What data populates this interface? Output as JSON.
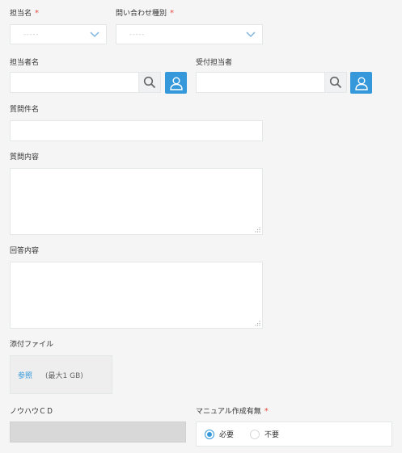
{
  "form": {
    "assignee_select": {
      "label": "担当名",
      "required_mark": "*",
      "placeholder": "-----"
    },
    "inquiry_type_select": {
      "label": "問い合わせ種別",
      "required_mark": "*",
      "placeholder": "-----"
    },
    "assignee_name": {
      "label": "担当者名",
      "value": ""
    },
    "receiver": {
      "label": "受付担当者",
      "value": ""
    },
    "question_title": {
      "label": "質問件名",
      "value": ""
    },
    "question_content": {
      "label": "質問内容",
      "value": ""
    },
    "answer_content": {
      "label": "回答内容",
      "value": ""
    },
    "attachment": {
      "label": "添付ファイル",
      "browse_label": "参照",
      "limit": "(最大1 GB)"
    },
    "knowhow_cd": {
      "label": "ノウハウＣＤ",
      "value": ""
    },
    "manual_creation": {
      "label": "マニュアル作成有無",
      "required_mark": "*",
      "options": [
        {
          "label": "必要",
          "checked": true
        },
        {
          "label": "不要",
          "checked": false
        }
      ]
    }
  },
  "colors": {
    "accent": "#3498db",
    "required": "#e74c3c",
    "background": "#f5f5f5"
  },
  "icons": [
    "chevron-down-icon",
    "search-icon",
    "user-icon",
    "resize-grip-icon"
  ]
}
